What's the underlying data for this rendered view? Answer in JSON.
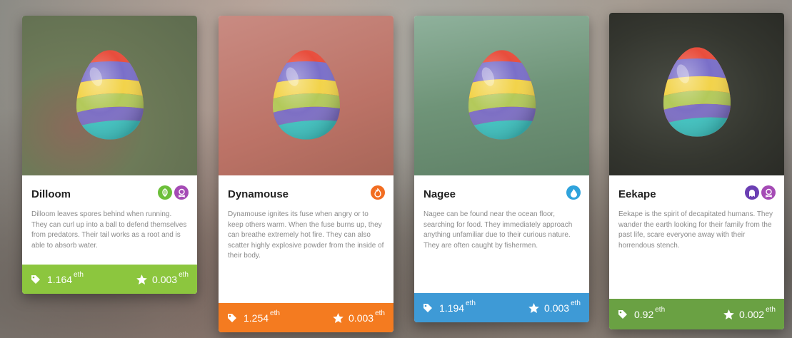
{
  "cards": [
    {
      "name": "Dilloom",
      "description": "Dilloom leaves spores behind when running. They can curl up into a ball to defend themselves from predators. Their tail works as a root and is able to absorb water.",
      "price": "1.164",
      "price_unit": "eth",
      "rating": "0.003",
      "rating_unit": "eth",
      "types": [
        "leaf-icon",
        "skull-icon"
      ],
      "footer_color": "#8cc63e",
      "image_bg": "#6f7d58"
    },
    {
      "name": "Dynamouse",
      "description": "Dynamouse ignites its fuse when angry or to keep others warm. When the fuse burns up, they can breathe extremely hot fire. They can also scatter highly explosive powder from the inside of their body.",
      "price": "1.254",
      "price_unit": "eth",
      "rating": "0.003",
      "rating_unit": "eth",
      "types": [
        "fire-icon"
      ],
      "footer_color": "#f47b20",
      "image_bg": "#c1786b"
    },
    {
      "name": "Nagee",
      "description": "Nagee can be found near the ocean floor, searching for food. They immediately approach anything unfamiliar due to their curious nature. They are often caught by fishermen.",
      "price": "1.194",
      "price_unit": "eth",
      "rating": "0.003",
      "rating_unit": "eth",
      "types": [
        "water-drop-icon"
      ],
      "footer_color": "#3e9ad6",
      "image_bg": "#6f9478"
    },
    {
      "name": "Eekape",
      "description": "Eekape is the spirit of decapitated humans. They wander the earth looking for their family from the past life, scare everyone away with their horrendous stench.",
      "price": "0.92",
      "price_unit": "eth",
      "rating": "0.002",
      "rating_unit": "eth",
      "types": [
        "ghost-icon",
        "skull-icon"
      ],
      "footer_color": "#6aa143",
      "image_bg": "#3a3d36"
    }
  ],
  "type_colors": {
    "leaf-icon": "#6cbf3a",
    "skull-icon": "#a54bb5",
    "fire-icon": "#f26d21",
    "water-drop-icon": "#2fa3dc",
    "ghost-icon": "#6b3fb3"
  },
  "icons": {
    "price": "tag-icon",
    "rating": "star-icon"
  }
}
